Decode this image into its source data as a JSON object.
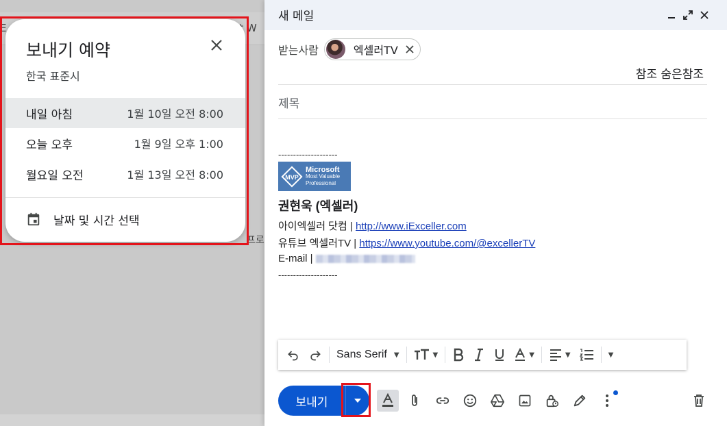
{
  "background": {
    "text_left": "E",
    "text_right": "at W",
    "text_mid": "프로그램"
  },
  "schedule_popup": {
    "title": "보내기 예약",
    "subtitle": "한국 표준시",
    "options": [
      {
        "label": "내일 아침",
        "time": "1월 10일 오전 8:00"
      },
      {
        "label": "오늘 오후",
        "time": "1월 9일 오후 1:00"
      },
      {
        "label": "월요일 오전",
        "time": "1월 13일 오전 8:00"
      }
    ],
    "custom_label": "날짜 및 시간 선택"
  },
  "compose": {
    "title": "새 메일",
    "to_label": "받는사람",
    "recipient": "엑셀러TV",
    "cc_bcc": "참조 숨은참조",
    "subject_placeholder": "제목",
    "signature": {
      "dashes_top": "--------------------",
      "mvp_line1": "Microsoft",
      "mvp_line2": "Most Valuable",
      "mvp_line3": "Professional",
      "mvp_badge": "MVP",
      "name": "권현욱 (엑셀러)",
      "line1_prefix": "아이엑셀러 닷컴 | ",
      "line1_link": "http://www.iExceller.com",
      "line2_prefix": "유튜브 엑셀러TV | ",
      "line2_link": "https://www.youtube.com/@excellerTV",
      "line3_prefix": "E-mail | ",
      "dashes_bottom": "--------------------"
    },
    "toolbar": {
      "font": "Sans Serif"
    },
    "send_label": "보내기"
  },
  "colors": {
    "send_blue": "#0b57d0",
    "highlight_red": "#e4141b",
    "link_blue": "#1a3fb8"
  }
}
